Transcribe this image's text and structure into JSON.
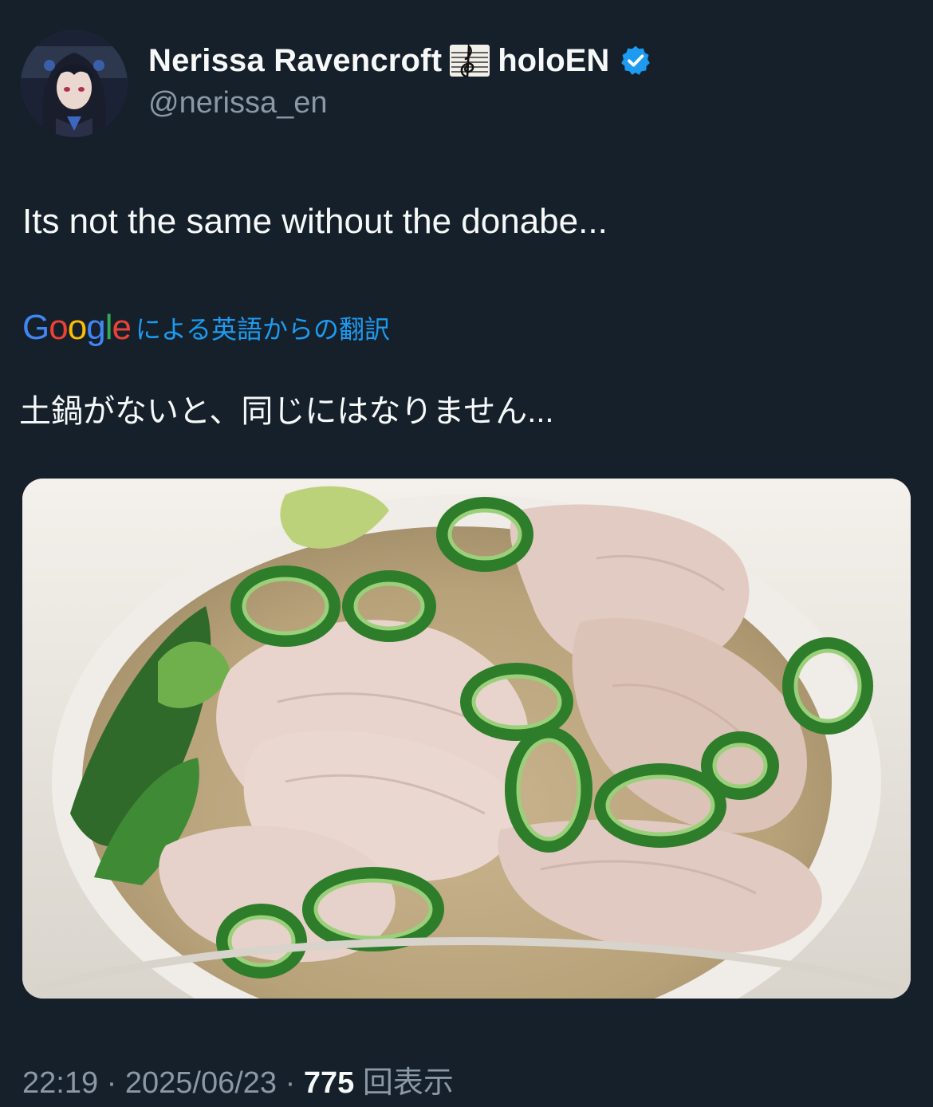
{
  "author": {
    "display_name": "Nerissa Ravencroft",
    "name_emoji": "musical-score-icon",
    "org_suffix": "holoEN",
    "verified": true,
    "handle": "@nerissa_en",
    "avatar_icon": "avatar-illustration"
  },
  "tweet": {
    "text": "Its not the same without the donabe...",
    "translation": {
      "provider": "Google",
      "label": "による英語からの翻訳",
      "text": "土鍋がないと、同じにはなりません..."
    },
    "media": {
      "type": "photo",
      "subject": "pork-and-green-onion-nabe-in-white-pot"
    }
  },
  "meta": {
    "time": "22:19",
    "separator": "·",
    "date": "2025/06/23",
    "views_count": "775",
    "views_label": "回表示"
  },
  "colors": {
    "background": "#15202b",
    "primary_text": "#f7f9f9",
    "secondary_text": "#8b98a5",
    "link_blue": "#1d9bf0",
    "verified_blue": "#1d9bf0"
  }
}
